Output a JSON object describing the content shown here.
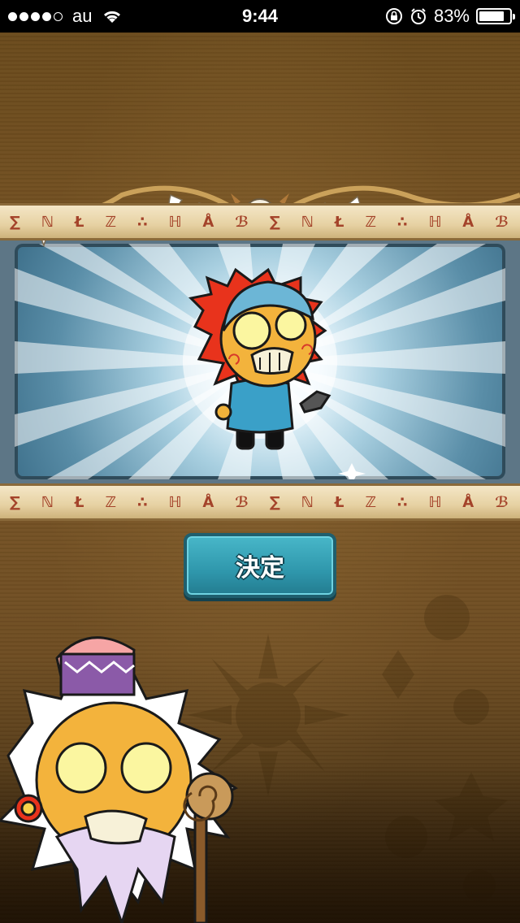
{
  "status_bar": {
    "carrier": "au",
    "time": "9:44",
    "battery_percent": "83%",
    "battery_level": 0.83,
    "signal_dots_filled": 4,
    "signal_dots_total": 5,
    "icons": [
      "wifi-icon",
      "rotation-lock-icon",
      "alarm-icon",
      "battery-icon"
    ]
  },
  "reward_panel": {
    "character": "zombie-boy-character"
  },
  "actions": {
    "decide_label": "決定"
  },
  "colors": {
    "button": "#2f97ac",
    "plank_glyph": "#a4432a",
    "background": "#6b4a1f"
  }
}
